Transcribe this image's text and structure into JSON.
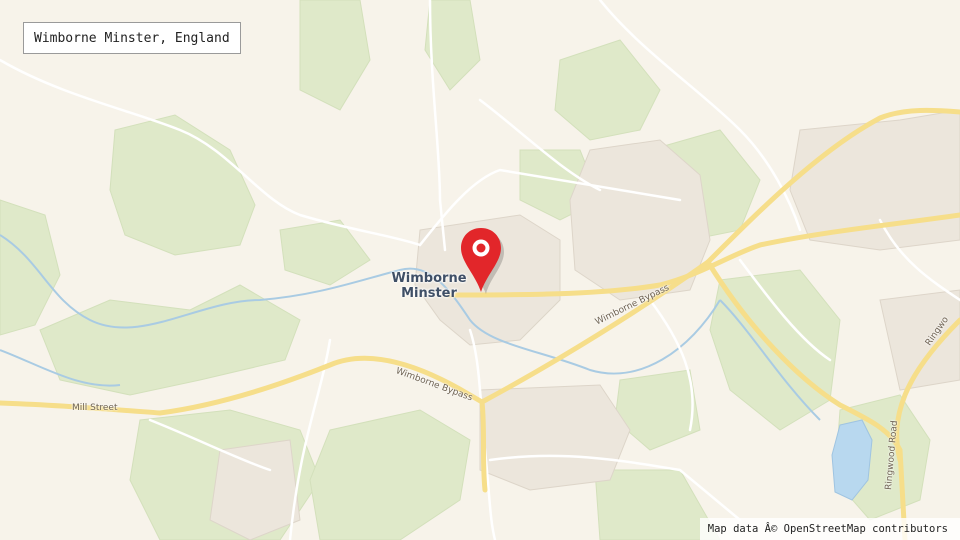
{
  "search": {
    "location": "Wimborne Minster, England"
  },
  "map": {
    "town_label": "Wimborne Minster",
    "roads": {
      "bypass_east": "Wimborne Bypass",
      "bypass_west": "Wimborne Bypass",
      "mill_street": "Mill Street",
      "ringwood_road": "Ringwood Road",
      "ringwood_edge": "Ringwo"
    }
  },
  "attribution": "Map data Â© OpenStreetMap contributors",
  "colors": {
    "land": "#f7f3ea",
    "woodland": "#dfe9c9",
    "river": "#a9cbe3",
    "water": "#b8d8ef",
    "major_road": "#f6de8a",
    "minor_road": "#ffffff",
    "pin": "#e2262a"
  },
  "icons": {
    "marker": "map-pin-icon"
  }
}
